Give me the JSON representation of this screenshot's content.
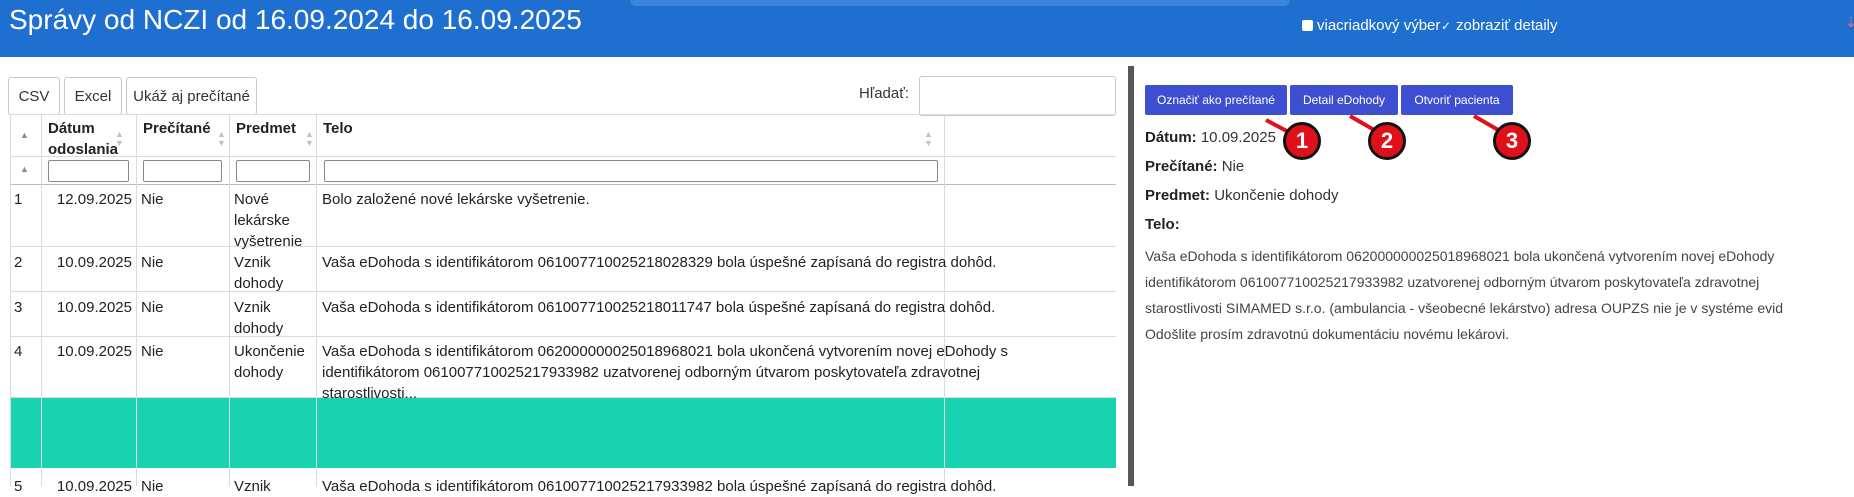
{
  "header": {
    "title": "Správy od NCZI od 16.09.2024 do 16.09.2025",
    "multi_select_label": "viacriadkový výber",
    "show_details_label": "zobraziť detaily",
    "accent": "#1e6fcf"
  },
  "toolbar": {
    "csv": "CSV",
    "excel": "Excel",
    "show_read": "Ukáž aj prečítané",
    "search_label": "Hľadať:",
    "search_value": ""
  },
  "table": {
    "sort_glyph": "▲",
    "headers": {
      "date_line1": "Dátum",
      "date_line2": "odoslania",
      "read": "Prečítané",
      "subject": "Predmet",
      "body": "Telo"
    },
    "rows": [
      {
        "num": "1",
        "date": "12.09.2025",
        "read": "Nie",
        "subject": [
          "Nové",
          "lekárske",
          "vyšetrenie"
        ],
        "body": [
          "Bolo založené nové lekárske vyšetrenie."
        ]
      },
      {
        "num": "2",
        "date": "10.09.2025",
        "read": "Nie",
        "subject": [
          "Vznik",
          "dohody"
        ],
        "body": [
          "Vaša eDohoda s identifikátorom 061007710025218028329 bola úspešné zapísaná do registra dohôd."
        ]
      },
      {
        "num": "3",
        "date": "10.09.2025",
        "read": "Nie",
        "subject": [
          "Vznik",
          "dohody"
        ],
        "body": [
          "Vaša eDohoda s identifikátorom 061007710025218011747 bola úspešné zapísaná do registra dohôd."
        ]
      },
      {
        "num": "4",
        "date": "10.09.2025",
        "read": "Nie",
        "subject": [
          "Ukončenie",
          "dohody"
        ],
        "body": [
          "Vaša eDohoda s identifikátorom 062000000025018968021 bola ukončená vytvorením novej eDohody s",
          "identifikátorom 061007710025217933982 uzatvorenej odborným útvarom poskytovateľa zdravotnej",
          "starostlivosti..."
        ],
        "selected": true
      },
      {
        "num": "5",
        "date": "10.09.2025",
        "read": "Nie",
        "subject": [
          "Vznik"
        ],
        "body": [
          "Vaša eDohoda s identifikátorom 061007710025217933982 bola úspešné zapísaná do registra dohôd."
        ]
      }
    ],
    "selected_color": "#19d3b0"
  },
  "actions": {
    "mark_read": "Označiť ako prečítané",
    "detail": "Detail eDohody",
    "open_patient": "Otvoriť pacienta",
    "button_color": "#3d4fd0"
  },
  "markers": [
    "1",
    "2",
    "3"
  ],
  "detail": {
    "date_label": "Dátum:",
    "date_value": "10.09.2025",
    "read_label": "Prečítané:",
    "read_value": "Nie",
    "subject_label": "Predmet:",
    "subject_value": "Ukončenie dohody",
    "body_label": "Telo:",
    "body_lines": [
      "Vaša eDohoda s identifikátorom 062000000025018968021 bola ukončená vytvorením novej eDohody",
      "identifikátorom 061007710025217933982 uzatvorenej odborným útvarom poskytovateľa zdravotnej",
      "starostlivosti SIMAMED s.r.o. (ambulancia - všeobecné lekárstvo) adresa OUPZS nie je v systéme evid",
      "Odošlite prosím zdravotnú dokumentáciu novému lekárovi."
    ]
  }
}
